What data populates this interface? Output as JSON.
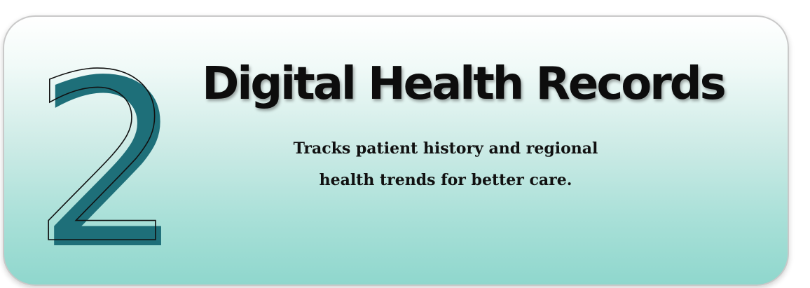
{
  "card": {
    "number": "2",
    "title": "Digital Health Records",
    "description_lines": [
      "Tracks patient history and regional",
      "health trends for better care."
    ]
  },
  "colors": {
    "numeral_fill": "#1e6f79",
    "numeral_outline": "#111111",
    "gradient_top": "#ffffff",
    "gradient_bottom": "#8fd7cd",
    "title_text": "#0d0d0d"
  }
}
